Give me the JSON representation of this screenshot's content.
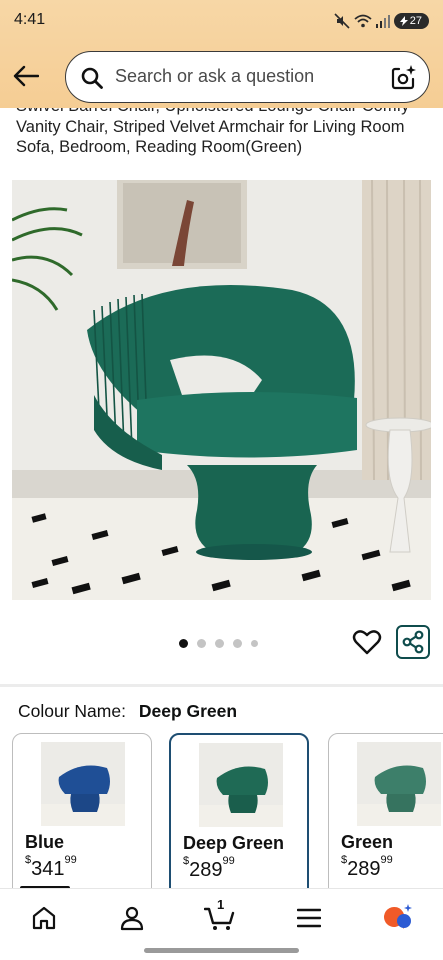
{
  "status_bar": {
    "time": "4:41",
    "battery": "27"
  },
  "search": {
    "placeholder": "Search or ask a question"
  },
  "product": {
    "title": "Swivel Barrel Chair, Upholstered Lounge Chair Comfy Vanity Chair, Striped Velvet Armchair for Living Room Sofa, Bedroom, Reading Room(Green)"
  },
  "carousel": {
    "dot_count": 5,
    "active_index": 0
  },
  "colour": {
    "label": "Colour Name:",
    "selected": "Deep Green",
    "options": [
      {
        "name": "Blue",
        "currency": "$",
        "whole": "341",
        "fraction": "99",
        "color": "#1f4f96"
      },
      {
        "name": "Deep Green",
        "currency": "$",
        "whole": "289",
        "fraction": "99",
        "color": "#1f6a55"
      },
      {
        "name": "Green",
        "currency": "$",
        "whole": "289",
        "fraction": "99",
        "color": "#3d7f6a"
      }
    ]
  },
  "bottom_nav": {
    "cart_count": "1"
  },
  "colors": {
    "header_bg": "#f5cd94",
    "chair_green": "#1b6b57",
    "selected_border": "#1e4e72",
    "share_border": "#0f4c4c"
  },
  "icons": [
    "back-arrow-icon",
    "search-icon",
    "camera-lens-icon",
    "heart-icon",
    "share-icon",
    "home-icon",
    "account-icon",
    "cart-icon",
    "menu-icon",
    "ai-assistant-icon"
  ]
}
